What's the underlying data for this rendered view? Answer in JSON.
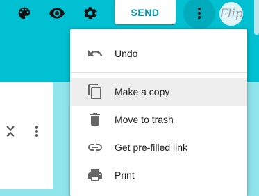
{
  "topbar": {
    "send_label": "SEND",
    "avatar_text": "Flip",
    "icons": [
      "palette-icon",
      "eye-icon",
      "gear-icon",
      "more-vert-icon"
    ],
    "accent_color": "#00c0d1"
  },
  "menu": {
    "items": [
      {
        "label": "Undo",
        "icon": "undo-icon"
      },
      {
        "label": "Make a copy",
        "icon": "copy-icon",
        "highlighted": true
      },
      {
        "label": "Move to trash",
        "icon": "trash-icon"
      },
      {
        "label": "Get pre-filled link",
        "icon": "link-icon"
      },
      {
        "label": "Print",
        "icon": "print-icon"
      }
    ]
  }
}
